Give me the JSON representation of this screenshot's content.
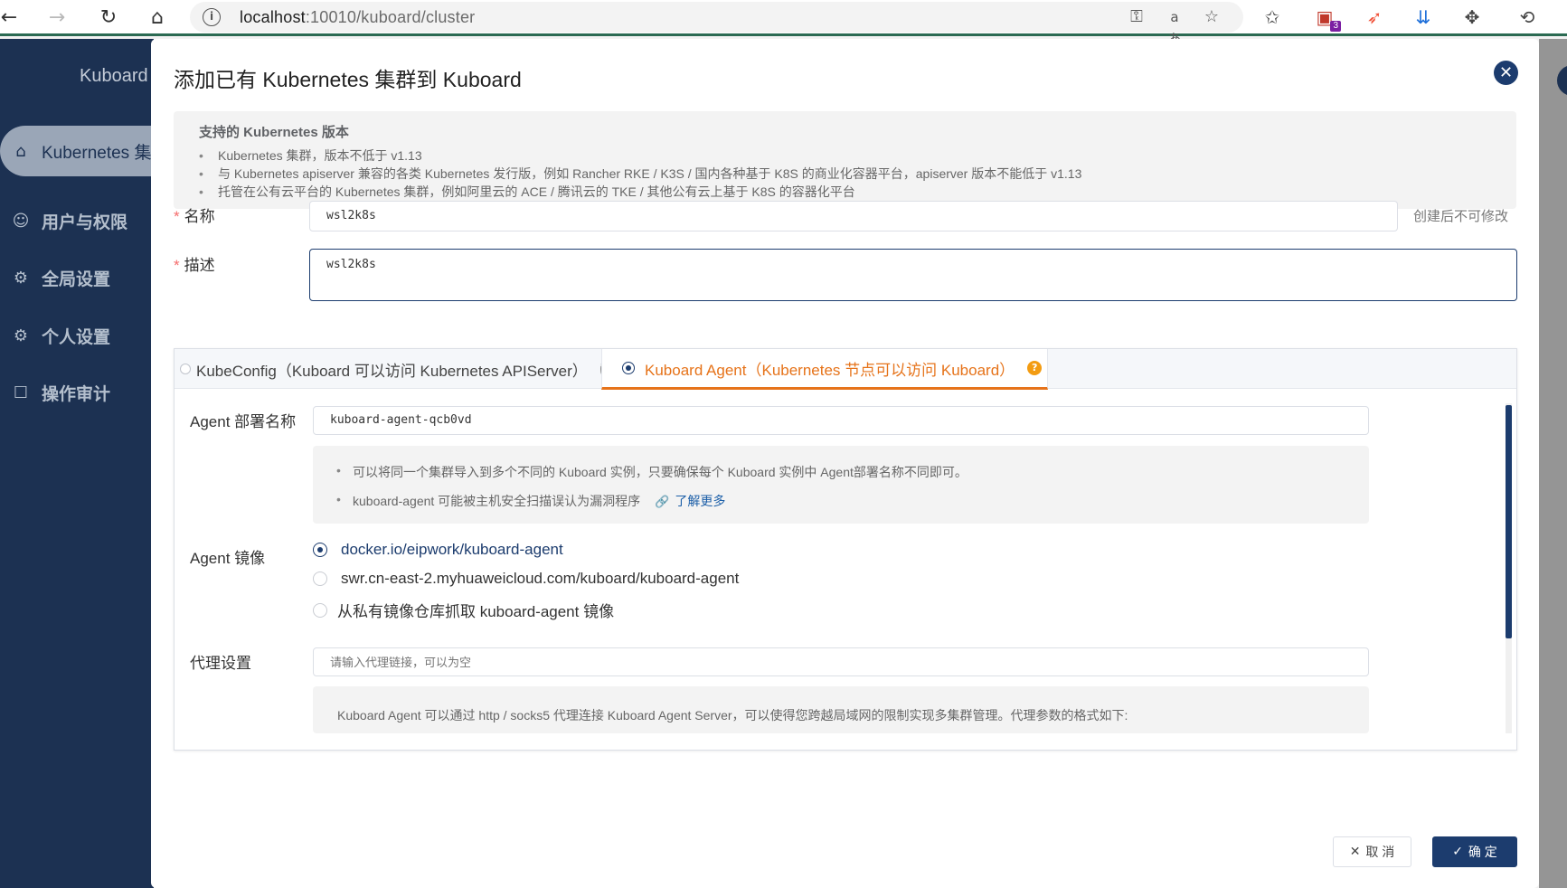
{
  "browser": {
    "url_host": "localhost",
    "url_path": ":10010/kuboard/cluster",
    "extension_badge": "3"
  },
  "sidebar": {
    "brand": "Kuboard",
    "items": [
      {
        "label": "Kubernetes 集群"
      },
      {
        "label": "用户与权限"
      },
      {
        "label": "全局设置"
      },
      {
        "label": "个人设置"
      },
      {
        "label": "操作审计"
      }
    ]
  },
  "dialog": {
    "title": "添加已有 Kubernetes 集群到 Kuboard",
    "support": {
      "title": "支持的 Kubernetes 版本",
      "items": [
        "Kubernetes 集群，版本不低于 v1.13",
        "与 Kubernetes apiserver 兼容的各类 Kubernetes 发行版，例如 Rancher RKE / K3S / 国内各种基于 K8S 的商业化容器平台，apiserver 版本不能低于 v1.13",
        "托管在公有云平台的 Kubernetes 集群，例如阿里云的 ACE / 腾讯云的 TKE / 其他公有云上基于 K8S 的容器化平台"
      ]
    },
    "name_label": "名称",
    "name_value": "wsl2k8s",
    "name_hint": "创建后不可修改",
    "desc_label": "描述",
    "desc_value": "wsl2k8s",
    "tabs": [
      {
        "label": "KubeConfig（Kuboard 可以访问 Kubernetes APIServer）",
        "selected": false
      },
      {
        "label": "Kuboard Agent（Kubernetes 节点可以访问 Kuboard）",
        "selected": true
      }
    ],
    "agent_name_label": "Agent 部署名称",
    "agent_name_value": "kuboard-agent-qcb0vd",
    "agent_notes": [
      "可以将同一个集群导入到多个不同的 Kuboard 实例，只要确保每个 Kuboard 实例中 Agent部署名称不同即可。",
      "kuboard-agent 可能被主机安全扫描误认为漏洞程序"
    ],
    "learn_more": "了解更多",
    "image_label": "Agent 镜像",
    "image_options": [
      {
        "label": "docker.io/eipwork/kuboard-agent",
        "selected": true
      },
      {
        "label": "swr.cn-east-2.myhuaweicloud.com/kuboard/kuboard-agent",
        "selected": false
      },
      {
        "label": "从私有镜像仓库抓取 kuboard-agent 镜像",
        "selected": false
      }
    ],
    "proxy_label": "代理设置",
    "proxy_placeholder": "请输入代理链接，可以为空",
    "proxy_note": "Kuboard Agent 可以通过 http / socks5 代理连接 Kuboard Agent Server，可以使得您跨越局域网的限制实现多集群管理。代理参数的格式如下:",
    "cancel_label": "取 消",
    "ok_label": "确 定"
  }
}
